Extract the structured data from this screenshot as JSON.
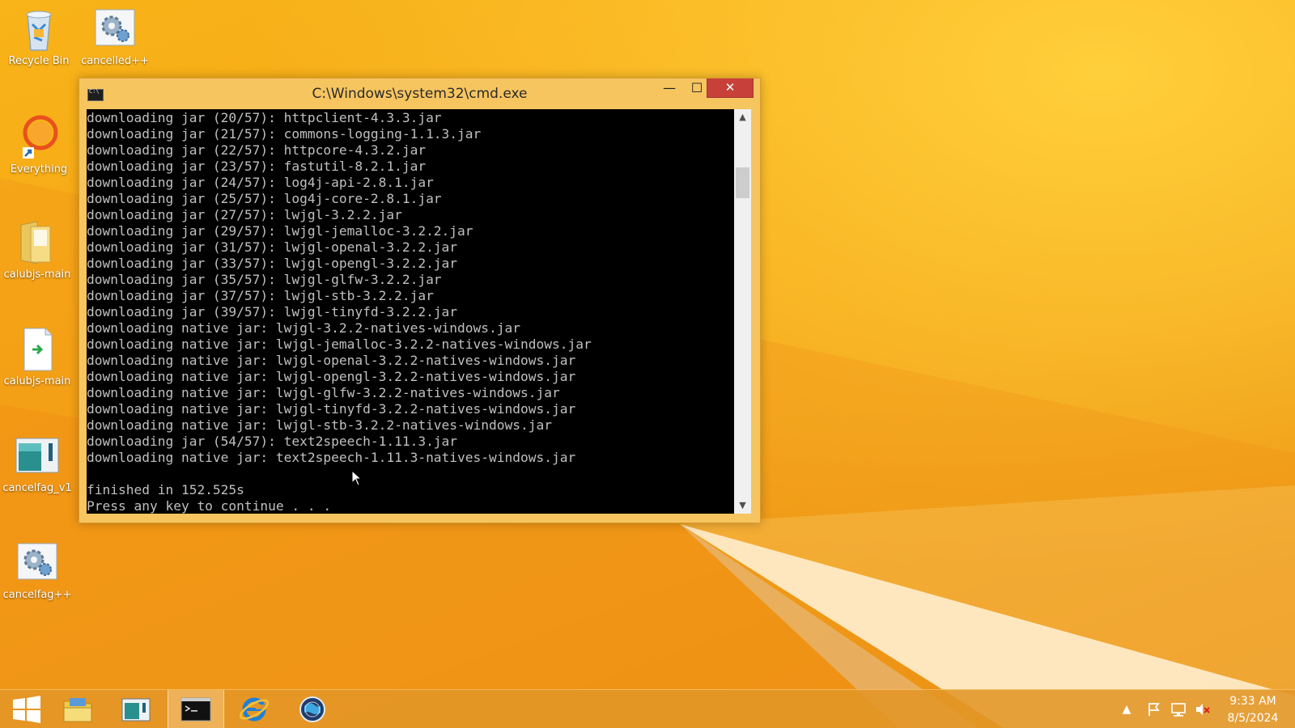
{
  "desktop": {
    "icons": [
      {
        "label": "Recycle Bin",
        "icon": "recycle-bin-icon"
      },
      {
        "label": "cancelled++",
        "icon": "settings-app-icon"
      },
      {
        "label": "Everything",
        "icon": "everything-search-icon"
      },
      {
        "label": "calubjs-main",
        "icon": "folder-icon"
      },
      {
        "label": "calubjs-main",
        "icon": "file-shortcut-icon"
      },
      {
        "label": "cancelfag_v1",
        "icon": "window-app-icon"
      },
      {
        "label": "cancelfag++",
        "icon": "settings-app-icon"
      }
    ]
  },
  "window": {
    "title": "C:\\Windows\\system32\\cmd.exe",
    "minimize_glyph": "—",
    "maximize_glyph": "☐",
    "close_glyph": "✕",
    "lines": [
      "downloading jar (20/57): httpclient-4.3.3.jar",
      "downloading jar (21/57): commons-logging-1.1.3.jar",
      "downloading jar (22/57): httpcore-4.3.2.jar",
      "downloading jar (23/57): fastutil-8.2.1.jar",
      "downloading jar (24/57): log4j-api-2.8.1.jar",
      "downloading jar (25/57): log4j-core-2.8.1.jar",
      "downloading jar (27/57): lwjgl-3.2.2.jar",
      "downloading jar (29/57): lwjgl-jemalloc-3.2.2.jar",
      "downloading jar (31/57): lwjgl-openal-3.2.2.jar",
      "downloading jar (33/57): lwjgl-opengl-3.2.2.jar",
      "downloading jar (35/57): lwjgl-glfw-3.2.2.jar",
      "downloading jar (37/57): lwjgl-stb-3.2.2.jar",
      "downloading jar (39/57): lwjgl-tinyfd-3.2.2.jar",
      "downloading native jar: lwjgl-3.2.2-natives-windows.jar",
      "downloading native jar: lwjgl-jemalloc-3.2.2-natives-windows.jar",
      "downloading native jar: lwjgl-openal-3.2.2-natives-windows.jar",
      "downloading native jar: lwjgl-opengl-3.2.2-natives-windows.jar",
      "downloading native jar: lwjgl-glfw-3.2.2-natives-windows.jar",
      "downloading native jar: lwjgl-tinyfd-3.2.2-natives-windows.jar",
      "downloading native jar: lwjgl-stb-3.2.2-natives-windows.jar",
      "downloading jar (54/57): text2speech-1.11.3.jar",
      "downloading native jar: text2speech-1.11.3-natives-windows.jar",
      "",
      "finished in 152.525s",
      "Press any key to continue . . ."
    ]
  },
  "taskbar": {
    "items": [
      {
        "icon": "windows-start-icon"
      },
      {
        "icon": "file-explorer-icon"
      },
      {
        "icon": "window-app-icon"
      },
      {
        "icon": "command-prompt-icon",
        "active": true
      },
      {
        "icon": "internet-explorer-icon"
      },
      {
        "icon": "globe-app-icon"
      }
    ],
    "tray": {
      "icons": [
        "show-hidden-icons-chevron",
        "action-center-flag-icon",
        "network-icon",
        "volume-muted-icon"
      ],
      "time": "9:33 AM",
      "date": "8/5/2024"
    }
  }
}
